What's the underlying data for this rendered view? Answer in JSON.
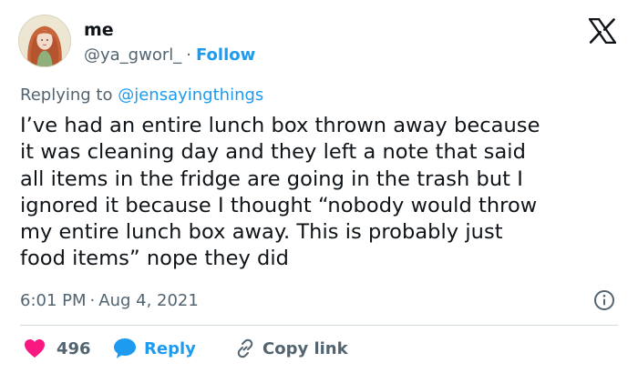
{
  "tweet": {
    "display_name": "me",
    "handle": "@ya_gworl_",
    "follow_label": "Follow",
    "replying_prefix": "Replying to",
    "replying_to": "@jensayingthings",
    "lines": [
      "I’ve had an entire lunch box thrown away because",
      "it was cleaning day and they left a note that said",
      "all items in the fridge are going in the trash but I",
      "ignored it because I thought “nobody would throw",
      "my entire lunch box away. This is probably just",
      "food items” nope they did"
    ],
    "time": "6:01 PM",
    "date": "Aug 4, 2021",
    "like_count": "496",
    "reply_label": "Reply",
    "copy_label": "Copy link"
  },
  "colors": {
    "accent": "#1d9bf0",
    "like": "#f91880",
    "muted": "#536471",
    "text": "#0f1419"
  },
  "icons": [
    "x-logo-icon",
    "info-icon",
    "heart-icon",
    "reply-bubble-icon",
    "link-icon"
  ]
}
